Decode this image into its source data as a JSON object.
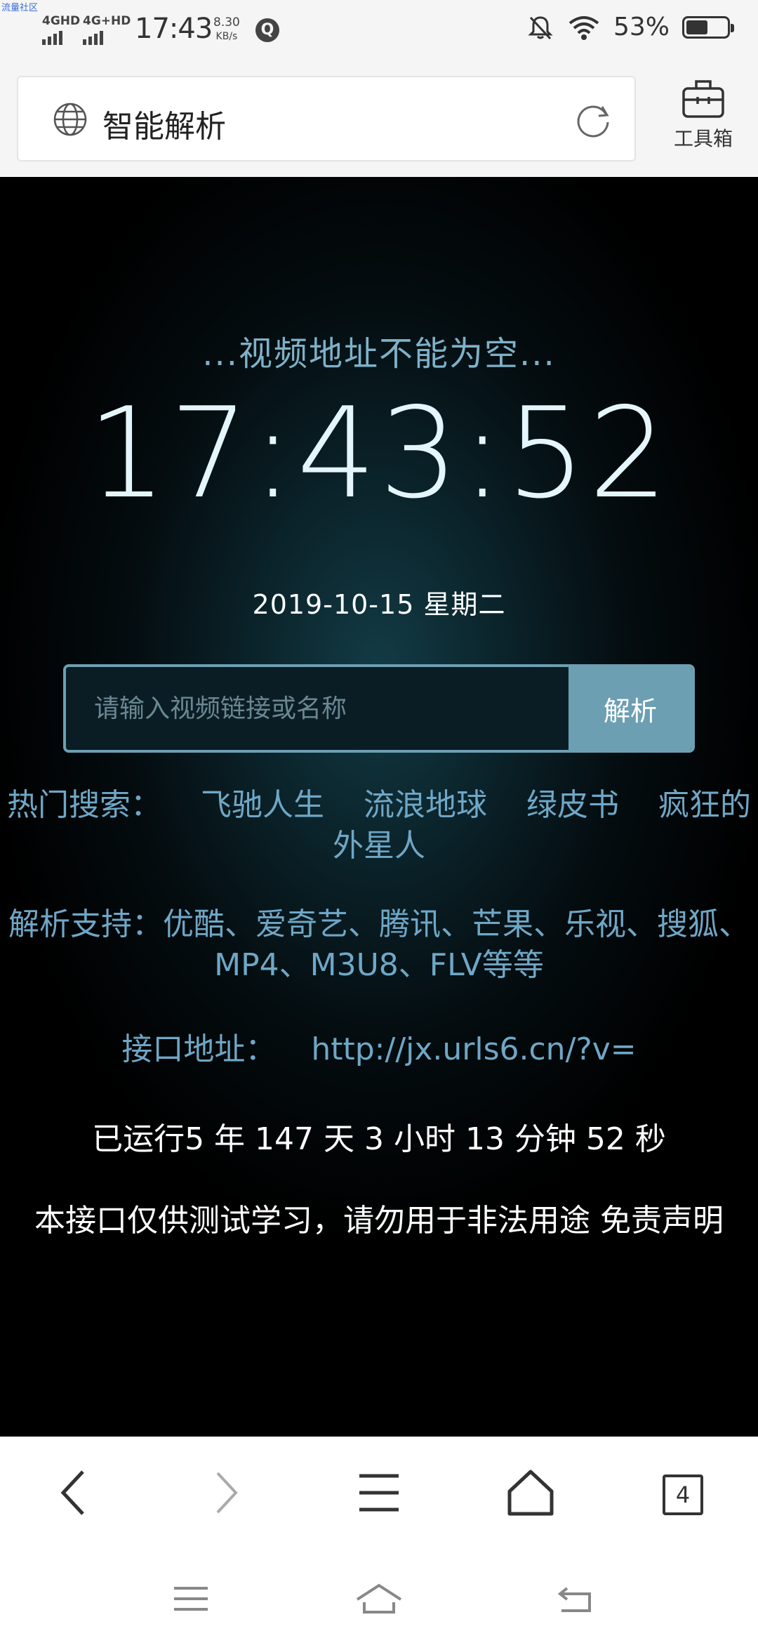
{
  "status_bar": {
    "watermark": "流量社区",
    "network1": "4GHD",
    "network2": "4G+HD",
    "time": "17:43",
    "speed_value": "8.30",
    "speed_unit": "KB/s",
    "app_icon": "Q",
    "battery_text": "53%",
    "battery_level": 0.53
  },
  "address_bar": {
    "title": "智能解析",
    "toolbox_label": "工具箱"
  },
  "page": {
    "tip": "...视频地址不能为空...",
    "clock": "17:43:52",
    "date": "2019-10-15 星期二",
    "search_placeholder": "请输入视频链接或名称",
    "search_button": "解析",
    "hot_label": "热门搜索：",
    "hot_items": [
      "飞驰人生",
      "流浪地球",
      "绿皮书",
      "疯狂的外星人"
    ],
    "support": "解析支持：优酷、爱奇艺、腾讯、芒果、乐视、搜狐、MP4、M3U8、FLV等等",
    "api_label": "接口地址：",
    "api_url": "http://jx.urls6.cn/?v=",
    "uptime": "已运行5 年 147 天 3 小时 13 分钟 52 秒",
    "disclaimer": "本接口仅供测试学习，请勿用于非法用途 免责声明"
  },
  "bottom_nav": {
    "tab_count": "4"
  },
  "colors": {
    "accent": "#6d9fb3",
    "link": "#6fa7c6",
    "clock": "#e4f6fb"
  }
}
